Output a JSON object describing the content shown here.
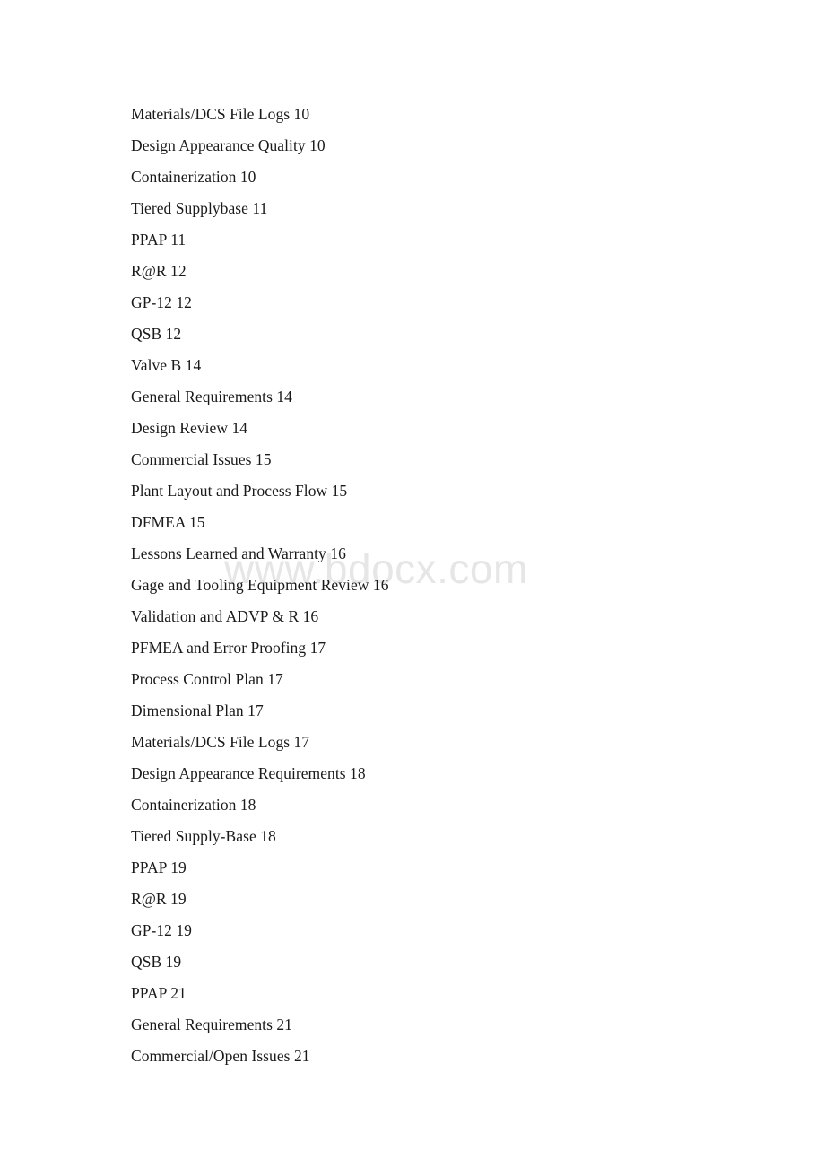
{
  "document": {
    "type": "table-of-contents",
    "background_color": "#ffffff",
    "text_color": "#1a1a1a"
  },
  "watermark": {
    "text": "www.bdocx.com",
    "color": "#e6e6e6"
  },
  "toc": {
    "entries": [
      {
        "title": "Materials/DCS File Logs",
        "page": "10",
        "line": "Materials/DCS File Logs 10"
      },
      {
        "title": "Design Appearance Quality",
        "page": "10",
        "line": "Design Appearance Quality 10"
      },
      {
        "title": "Containerization",
        "page": "10",
        "line": "Containerization 10"
      },
      {
        "title": "Tiered Supplybase",
        "page": "11",
        "line": "Tiered Supplybase 11"
      },
      {
        "title": "PPAP",
        "page": "11",
        "line": "PPAP 11"
      },
      {
        "title": "R@R",
        "page": "12",
        "line": "R@R 12"
      },
      {
        "title": "GP-12",
        "page": "12",
        "line": "GP-12 12"
      },
      {
        "title": "QSB",
        "page": "12",
        "line": "QSB 12"
      },
      {
        "title": "Valve B",
        "page": "14",
        "line": "Valve B 14"
      },
      {
        "title": "General Requirements",
        "page": "14",
        "line": "General Requirements 14"
      },
      {
        "title": "Design Review",
        "page": "14",
        "line": "Design Review 14"
      },
      {
        "title": "Commercial Issues",
        "page": "15",
        "line": "Commercial Issues 15"
      },
      {
        "title": "Plant Layout and Process Flow",
        "page": "15",
        "line": "Plant Layout and Process Flow 15"
      },
      {
        "title": "DFMEA",
        "page": "15",
        "line": "DFMEA 15"
      },
      {
        "title": "Lessons Learned and Warranty",
        "page": "16",
        "line": "Lessons Learned and Warranty 16"
      },
      {
        "title": "Gage and Tooling Equipment Review",
        "page": "16",
        "line": "Gage and Tooling Equipment Review 16"
      },
      {
        "title": "Validation and ADVP & R",
        "page": "16",
        "line": "Validation and ADVP & R 16"
      },
      {
        "title": "PFMEA and Error Proofing",
        "page": "17",
        "line": "PFMEA and Error Proofing 17"
      },
      {
        "title": "Process Control Plan",
        "page": "17",
        "line": "Process Control Plan 17"
      },
      {
        "title": "Dimensional Plan",
        "page": "17",
        "line": "Dimensional Plan 17"
      },
      {
        "title": "Materials/DCS File Logs",
        "page": "17",
        "line": "Materials/DCS File Logs 17"
      },
      {
        "title": "Design Appearance Requirements",
        "page": "18",
        "line": "Design Appearance Requirements 18"
      },
      {
        "title": "Containerization",
        "page": "18",
        "line": "Containerization 18"
      },
      {
        "title": "Tiered Supply-Base",
        "page": "18",
        "line": "Tiered Supply-Base 18"
      },
      {
        "title": "PPAP",
        "page": "19",
        "line": "PPAP 19"
      },
      {
        "title": "R@R",
        "page": "19",
        "line": "R@R 19"
      },
      {
        "title": "GP-12",
        "page": "19",
        "line": "GP-12 19"
      },
      {
        "title": "QSB",
        "page": "19",
        "line": "QSB 19"
      },
      {
        "title": "PPAP",
        "page": "21",
        "line": "PPAP 21"
      },
      {
        "title": "General Requirements",
        "page": "21",
        "line": "General Requirements 21"
      },
      {
        "title": "Commercial/Open Issues",
        "page": "21",
        "line": "Commercial/Open Issues 21"
      }
    ]
  }
}
